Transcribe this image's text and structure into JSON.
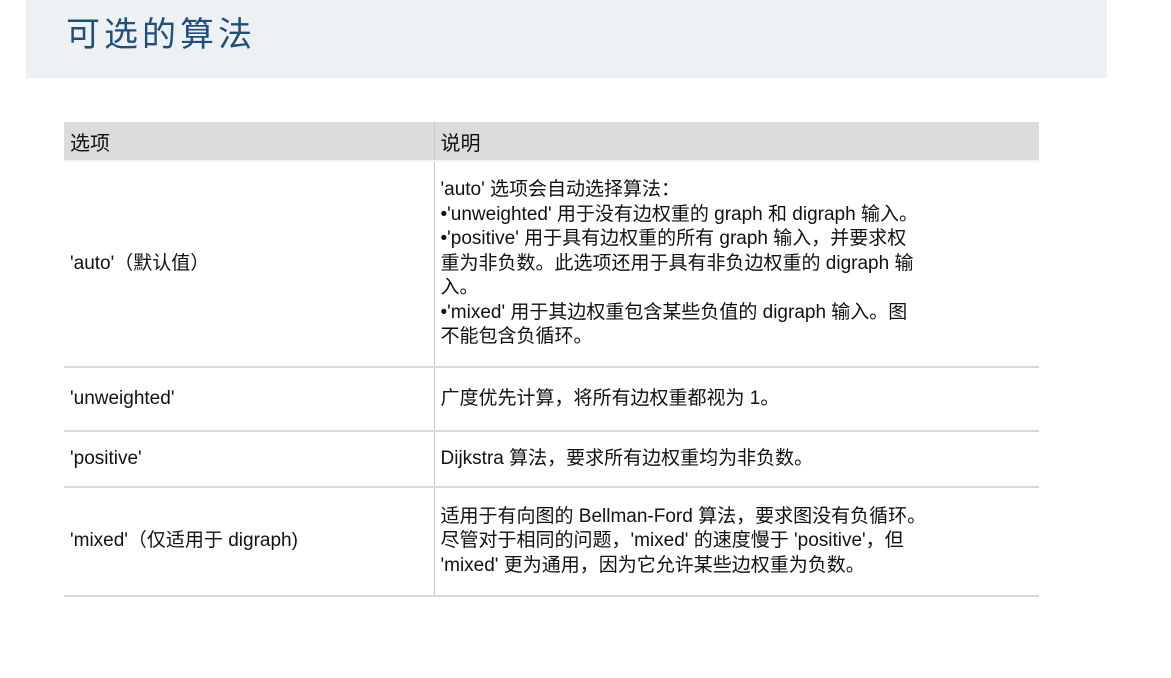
{
  "title": "可选的算法",
  "table": {
    "headers": [
      "选项",
      "说明"
    ],
    "rows": [
      {
        "option": "'auto'（默认值）",
        "description": [
          "'auto' 选项会自动选择算法：",
          "•'unweighted' 用于没有边权重的 graph 和 digraph 输入。",
          "•'positive' 用于具有边权重的所有 graph 输入，并要求权",
          "重为非负数。此选项还用于具有非负边权重的 digraph 输",
          "入。",
          "•'mixed' 用于其边权重包含某些负值的 digraph 输入。图",
          "不能包含负循环。"
        ]
      },
      {
        "option": "'unweighted'",
        "description": [
          "广度优先计算，将所有边权重都视为 1。"
        ]
      },
      {
        "option": "'positive'",
        "description": [
          "Dijkstra 算法，要求所有边权重均为非负数。"
        ]
      },
      {
        "option": "'mixed'（仅适用于 digraph)",
        "description": [
          "适用于有向图的 Bellman-Ford 算法，要求图没有负循环。",
          "尽管对于相同的问题，'mixed' 的速度慢于 'positive'，但",
          "'mixed' 更为通用，因为它允许某些边权重为负数。"
        ]
      }
    ]
  }
}
